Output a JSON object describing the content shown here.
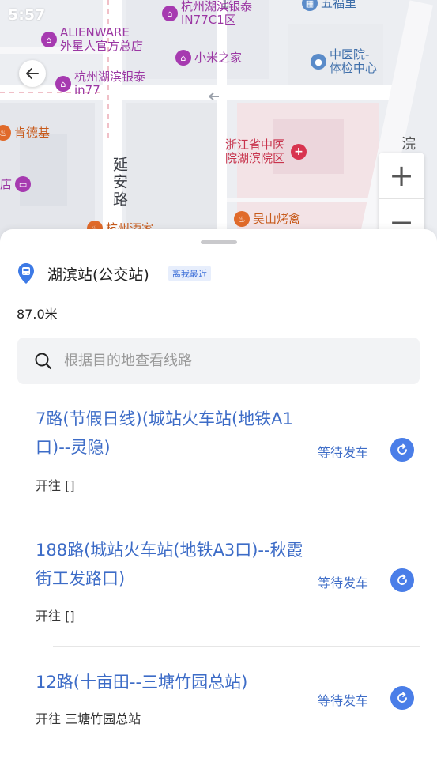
{
  "status_bar": {
    "time": "5:57"
  },
  "map": {
    "pois": [
      {
        "id": "yinxie",
        "lines": [
          "杭州湖滨银泰",
          "IN77C1区"
        ]
      },
      {
        "id": "wufuli",
        "lines": [
          "五福里"
        ]
      },
      {
        "id": "alienware",
        "lines": [
          "ALIENWARE",
          "外星人官方总店"
        ]
      },
      {
        "id": "xiaomi",
        "lines": [
          "小米之家"
        ]
      },
      {
        "id": "zhongyi-tijian",
        "lines": [
          "中医院-",
          "体检中心"
        ]
      },
      {
        "id": "hubin-in77",
        "lines": [
          "杭州湖滨银泰",
          "in77"
        ]
      },
      {
        "id": "kfc",
        "lines": [
          "肯德基"
        ]
      },
      {
        "id": "zhongyi-hubin",
        "lines": [
          "浙江省中医",
          "院湖滨院区"
        ]
      },
      {
        "id": "hotel",
        "lines": [
          "店"
        ]
      },
      {
        "id": "wushan",
        "lines": [
          "吴山烤禽"
        ]
      },
      {
        "id": "hangzhou-jiujia",
        "lines": [
          "杭州酒家"
        ]
      }
    ],
    "roads": {
      "yanan": "延安路",
      "right_road": "浣纱路"
    },
    "zoom_in": "+",
    "zoom_out": "−"
  },
  "station": {
    "name": "湖滨站(公交站)",
    "badge": "离我最近",
    "distance": "87.0米"
  },
  "search": {
    "placeholder": "根据目的地查看线路"
  },
  "routes": [
    {
      "name": "7路(节假日线)(城站火车站(地铁A1口)--灵隐)",
      "status": "等待发车",
      "dest": "开往 []"
    },
    {
      "name": "188路(城站火车站(地铁A3口)--秋霞街工发路口)",
      "status": "等待发车",
      "dest": "开往 []"
    },
    {
      "name": "12路(十亩田--三塘竹园总站)",
      "status": "等待发车",
      "dest": "开往 三塘竹园总站"
    }
  ],
  "colors": {
    "accent": "#3d6cc7",
    "refresh": "#4a7ee8",
    "poi_purple": "#a63ab0",
    "poi_orange": "#e06a2a",
    "poi_red": "#d8344f"
  }
}
